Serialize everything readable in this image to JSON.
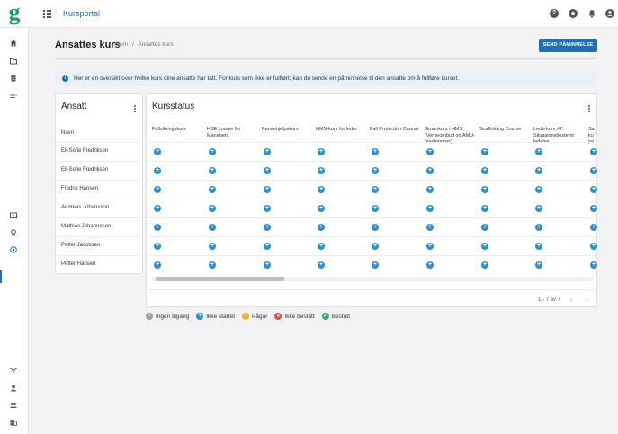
{
  "app": {
    "logo": "g",
    "title": "Kursportal"
  },
  "header": {
    "page_title": "Ansattes kurs",
    "breadcrumb": [
      "Hjem",
      "/",
      "Ansattes kurs"
    ],
    "send_button": "SEND PÅMINNELSE"
  },
  "info": {
    "text": "Her er en oversikt over hvilke kurs dine ansatte har tatt. For kurs som ikke er fullført, kan du sende en påminnelse til den ansatte om å fullføre kurset."
  },
  "employees": {
    "title": "Ansatt",
    "column_header": "Navn",
    "names": [
      "Eli-Sofie Fredriksen",
      "Eli-Sofie Fredriksen",
      "Fredrik Hansen",
      "Andreas Johansson",
      "Mathias Johannesen",
      "Petter Jacobsen",
      "Petter Hansen"
    ]
  },
  "course_status": {
    "title": "Kursstatus",
    "courses": [
      "Fallsikringskurs",
      "HSE course for Managers",
      "Førstehjelpskurs",
      "HMS-kurs for leder",
      "Fall Protection Course",
      "Grunnkurs i HMS (Verneombud og AMU-medlemmer)",
      "Scaffolding Course",
      "Lederkurs #2: Situasjonsbestemt ledelse",
      "Sa ku pa"
    ],
    "row_status": "Ikke startet",
    "pager": "1 - 7 av 7"
  },
  "legend": [
    {
      "label": "Ingen tilgang",
      "color": "#9e9e9e",
      "icon": "minus-icon",
      "glyph": "−"
    },
    {
      "label": "Ikke startet",
      "color": "#2b8fd6",
      "icon": "plus-icon",
      "glyph": "+"
    },
    {
      "label": "Pågår",
      "color": "#f2b01e",
      "icon": "ellipsis-icon",
      "glyph": "•"
    },
    {
      "label": "Ikke bestått",
      "color": "#e05252",
      "icon": "cross-icon",
      "glyph": "×"
    },
    {
      "label": "Bestått",
      "color": "#3aaa64",
      "icon": "check-icon",
      "glyph": "✓"
    }
  ]
}
